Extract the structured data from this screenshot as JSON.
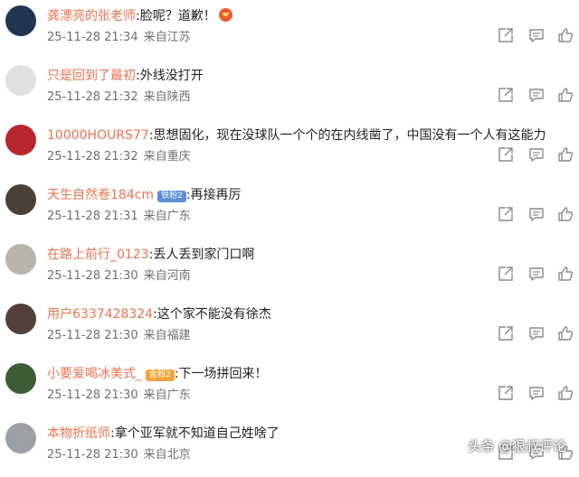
{
  "comments": [
    {
      "username": "龚漂亮的张老师",
      "text": "脸呢？道歉！",
      "emoji": "angry-face",
      "time": "25-11-28 21:34",
      "location": "来自江苏",
      "avatar_color": "#1f3550"
    },
    {
      "username": "只是回到了最初",
      "text": "外线没打开",
      "time": "25-11-28 21:32",
      "location": "来自陕西",
      "avatar_color": "#dfe1df"
    },
    {
      "username": "10000HOURS77",
      "text": "思想固化，现在没球队一个个的在内线凿了，中国没有一个人有这能力",
      "time": "25-11-28 21:32",
      "location": "来自重庆",
      "avatar_color": "#b8252b"
    },
    {
      "username": "天生自然卷184cm",
      "badge": "铁粉2",
      "badge_color": "#5b8fd6",
      "text": "再接再厉",
      "time": "25-11-28 21:31",
      "location": "来自广东",
      "avatar_color": "#4a4036"
    },
    {
      "username": "在路上前行_0123",
      "text": "丢人丢到家门口啊",
      "time": "25-11-28 21:30",
      "location": "来自河南",
      "avatar_color": "#b8b4ad"
    },
    {
      "username": "用户6337428324",
      "text": "这个家不能没有徐杰",
      "time": "25-11-28 21:30",
      "location": "来自福建",
      "avatar_color": "#53403a"
    },
    {
      "username": "小要爱喝冰美式_",
      "badge": "金粉2",
      "badge_color": "#f0a43a",
      "text": "下一场拼回来！",
      "time": "25-11-28 21:30",
      "location": "来自广东",
      "avatar_color": "#3b5c35"
    },
    {
      "username": "本物折纸师",
      "text": "拿个亚军就不知道自己姓啥了",
      "time": "25-11-28 21:30",
      "location": "来自北京",
      "avatar_color": "#9aa0a4"
    }
  ],
  "watermark": {
    "prefix": "头条",
    "handle": "@狠叔评论"
  },
  "colors": {
    "username": "#eb7350",
    "text": "#222222",
    "meta": "#6f6f6f",
    "icon": "#8a8a8a"
  }
}
